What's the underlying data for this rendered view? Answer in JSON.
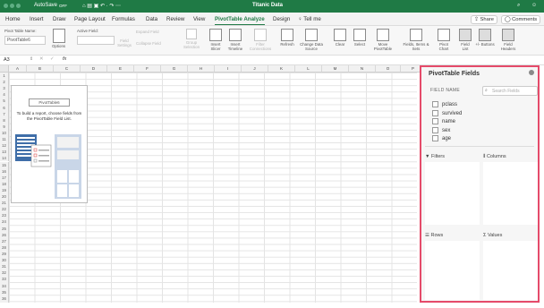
{
  "titlebar": {
    "autosave": "AutoSave",
    "autosave_state": "OFF",
    "doc_title": "Titanic Data"
  },
  "tabs": [
    "Home",
    "Insert",
    "Draw",
    "Page Layout",
    "Formulas",
    "Data",
    "Review",
    "View",
    "PivotTable Analyze",
    "Design",
    "Tell me"
  ],
  "active_tab": "PivotTable Analyze",
  "share": "Share",
  "comments": "Comments",
  "ribbon": {
    "pt_name_label": "Pivot Table Name:",
    "pt_name_value": "PivotTable6",
    "options": "Options",
    "active_field_label": "Active Field:",
    "field_settings": "Field Settings",
    "expand_field": "Expand Field",
    "collapse_field": "Collapse Field",
    "group_selection": "Group Selection",
    "insert_slicer": "Insert Slicer",
    "insert_timeline": "Insert Timeline",
    "filter_connections": "Filter Connections",
    "refresh": "Refresh",
    "change_data_source": "Change Data Source",
    "clear": "Clear",
    "select": "Select",
    "move_pivottable": "Move PivotTable",
    "fields_items_sets": "Fields, Items & Sets",
    "pivot_chart": "Pivot Chart",
    "field_list": "Field List",
    "buttons": "+/- Buttons",
    "field_headers": "Field Headers"
  },
  "formula_bar": {
    "cell_ref": "A3",
    "fx": "fx"
  },
  "sheet": {
    "columns": [
      "A",
      "B",
      "C",
      "D",
      "E",
      "F",
      "G",
      "H",
      "I",
      "J",
      "K",
      "L",
      "M",
      "N",
      "O",
      "P"
    ],
    "rows": [
      "1",
      "2",
      "3",
      "4",
      "5",
      "6",
      "7",
      "8",
      "9",
      "10",
      "11",
      "12",
      "13",
      "14",
      "15",
      "16",
      "17",
      "18",
      "19",
      "20",
      "21",
      "22",
      "23",
      "24",
      "25",
      "26",
      "27",
      "28",
      "29",
      "30",
      "31",
      "32",
      "33",
      "34",
      "35",
      "36",
      "37"
    ],
    "placeholder_title": "PivotTable6",
    "placeholder_text": "To build a report, choose fields from the PivotTable Field List."
  },
  "pane": {
    "title": "PivotTable Fields",
    "field_name_label": "FIELD NAME",
    "search_placeholder": "Search Fields",
    "fields": [
      "pclass",
      "survived",
      "name",
      "sex",
      "age"
    ],
    "filters": "Filters",
    "columns": "Columns",
    "rows": "Rows",
    "values": "Values"
  },
  "colors": {
    "accent": "#1f7a45",
    "highlight": "#e54b6a"
  }
}
